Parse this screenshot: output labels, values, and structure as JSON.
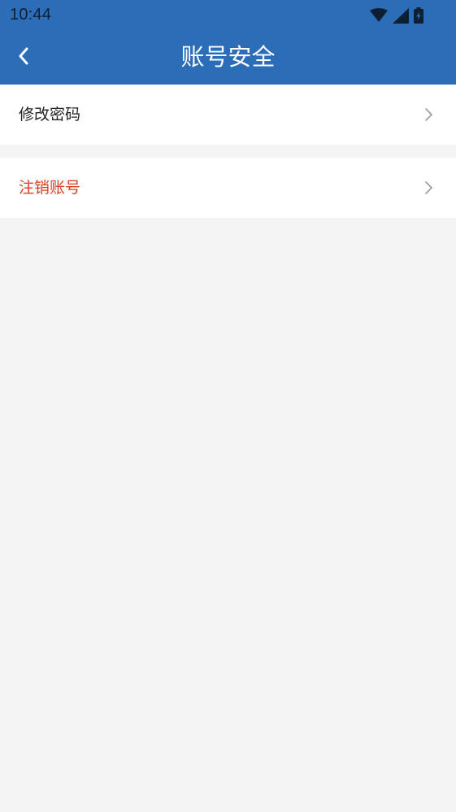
{
  "status_bar": {
    "time": "10:44",
    "icons": [
      "wifi-icon",
      "cellular-signal-icon",
      "battery-charging-icon"
    ]
  },
  "nav": {
    "title": "账号安全",
    "back_icon": "chevron-left-icon"
  },
  "settings": {
    "items": [
      {
        "label": "修改密码",
        "icon": "chevron-right-icon"
      },
      {
        "label": "注销账号",
        "icon": "chevron-right-icon"
      }
    ]
  },
  "colors": {
    "header_background": "#2b6db7",
    "page_background": "#f4f4f4",
    "danger_text": "#e03a22",
    "item_text": "#222222"
  }
}
